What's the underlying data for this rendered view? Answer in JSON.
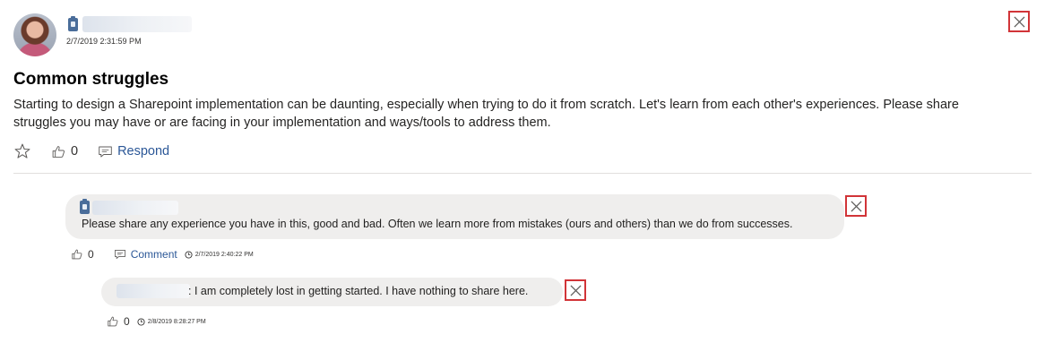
{
  "post": {
    "timestamp": "2/7/2019 2:31:59 PM",
    "title": "Common struggles",
    "body": "Starting to design a Sharepoint implementation can be daunting, especially when trying to do it from scratch. Let's learn from each other's experiences. Please share struggles you may have or are facing in your implementation and ways/tools to address them.",
    "like_count": "0",
    "respond_label": "Respond"
  },
  "comment": {
    "text": "Please share any experience you have in this, good and bad. Often we learn more from mistakes (ours and others) than we do from successes.",
    "like_count": "0",
    "comment_label": "Comment",
    "timestamp": "2/7/2019 2:40:22 PM"
  },
  "reply": {
    "text": ": I am completely lost in getting started. I have nothing to share here.",
    "like_count": "0",
    "timestamp": "2/8/2019 8:28:27 PM"
  },
  "icons": {
    "close": "close-icon",
    "star": "star-icon",
    "like": "thumbs-up-icon",
    "comment": "comment-icon",
    "clock": "clock-icon",
    "badge": "id-badge-icon"
  },
  "colors": {
    "link": "#2b5797",
    "close_border": "#d13438",
    "bubble": "#efeeed"
  }
}
